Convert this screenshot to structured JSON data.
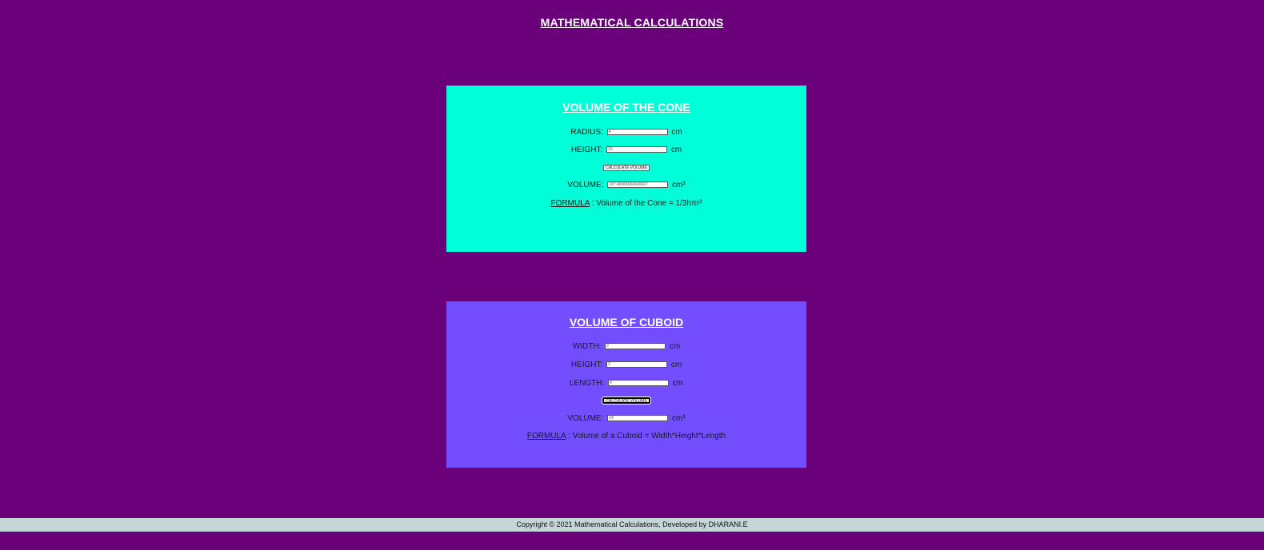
{
  "page": {
    "title": "MATHEMATICAL CALCULATIONS"
  },
  "cone": {
    "title": "VOLUME OF THE CONE",
    "radius_label": "RADIUS:",
    "radius_value": "4",
    "height_label": "HEIGHT:",
    "height_value": "10",
    "unit_cm": "cm",
    "button_label": "CALCULATE VOLUME",
    "volume_label": "VOLUME:",
    "volume_value": "167.46666666666667",
    "unit_cm3": "cm³",
    "formula_label": "FORMULA",
    "formula_text": " : Volume of the Cone = 1/3hπr²",
    "background_color": "#00ffd8"
  },
  "cuboid": {
    "title": "VOLUME OF CUBOID",
    "width_label": "WIDTH:",
    "width_value": "2",
    "height_label": "HEIGHT:",
    "height_value": "3",
    "length_label": "LENGTH:",
    "length_value": "4",
    "unit_cm": "cm",
    "button_label": "CALCULATE VOLUME",
    "volume_label": "VOLUME:",
    "volume_value": "24",
    "unit_cm3": "cm³",
    "formula_label": "FORMULA",
    "formula_text": " : Volume of a Cuboid = Width*Height*Length",
    "background_color": "#734eff"
  },
  "footer": {
    "text": "Copyright © 2021 Mathematical Calculations, Developed by DHARANI.E"
  },
  "colors": {
    "page_background": "#6a007a",
    "footer_background": "#c5d6d6"
  }
}
